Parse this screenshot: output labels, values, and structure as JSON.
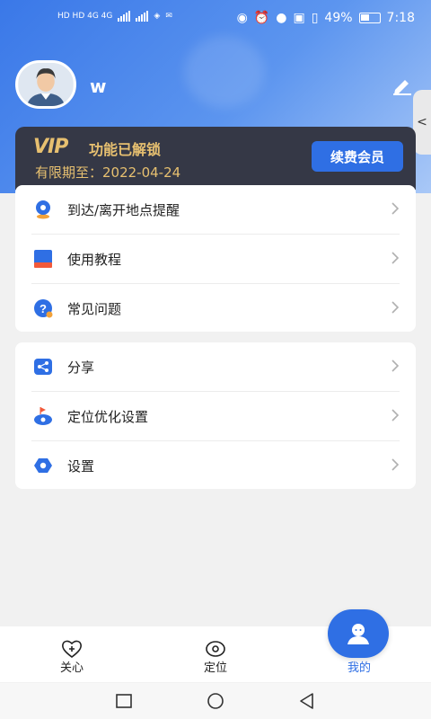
{
  "status_bar": {
    "left_glyphs": "HD HD 4G 4G",
    "battery": "49%",
    "time": "7:18"
  },
  "profile": {
    "username": "w"
  },
  "vip": {
    "logo_text": "VIP",
    "title": "功能已解锁",
    "expiry": "有限期至：2022-04-24",
    "renew_button": "续费会员"
  },
  "menu_group_1": [
    {
      "label": "到达/离开地点提醒",
      "icon": "location-pin-icon"
    },
    {
      "label": "使用教程",
      "icon": "book-icon"
    },
    {
      "label": "常见问题",
      "icon": "question-icon"
    }
  ],
  "menu_group_2": [
    {
      "label": "分享",
      "icon": "share-icon"
    },
    {
      "label": "定位优化设置",
      "icon": "location-optimize-icon"
    },
    {
      "label": "设置",
      "icon": "settings-icon"
    }
  ],
  "tabs": [
    {
      "label": "关心",
      "icon": "heart-plus-icon"
    },
    {
      "label": "定位",
      "icon": "location-eye-icon"
    },
    {
      "label": "我的",
      "icon": "user-icon"
    }
  ],
  "colors": {
    "accent": "#2f6fe4",
    "vip_gold": "#e7c070",
    "vip_bg": "#353846"
  }
}
